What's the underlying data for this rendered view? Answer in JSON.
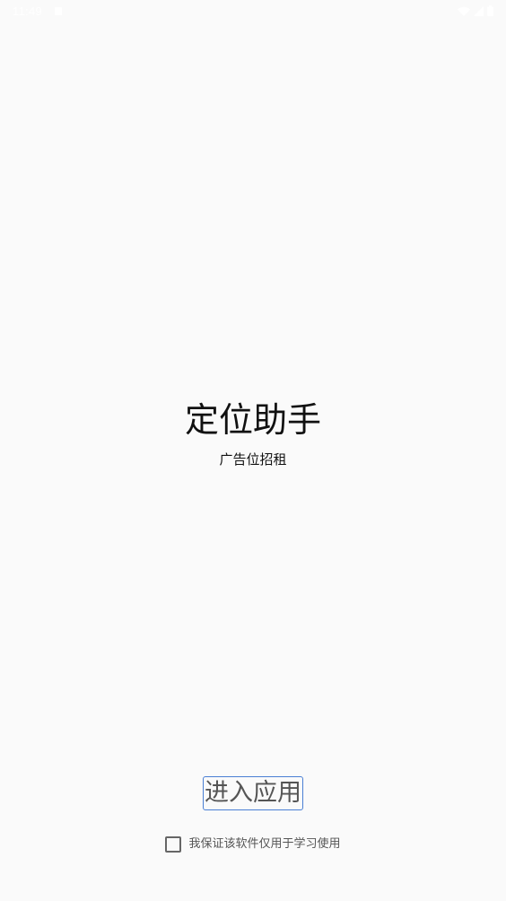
{
  "status_bar": {
    "time": "11:49",
    "icons": [
      "notification-icon",
      "wifi-icon",
      "signal-icon",
      "battery-icon"
    ]
  },
  "app": {
    "title": "定位助手",
    "subtitle": "广告位招租"
  },
  "enter_button": {
    "label": "进入应用"
  },
  "agreement": {
    "checked": false,
    "label": "我保证该软件仅用于学习使用"
  },
  "colors": {
    "background": "#fafafa",
    "button_border": "#4a7fd4",
    "text_primary": "#111111",
    "text_secondary": "#555555"
  }
}
